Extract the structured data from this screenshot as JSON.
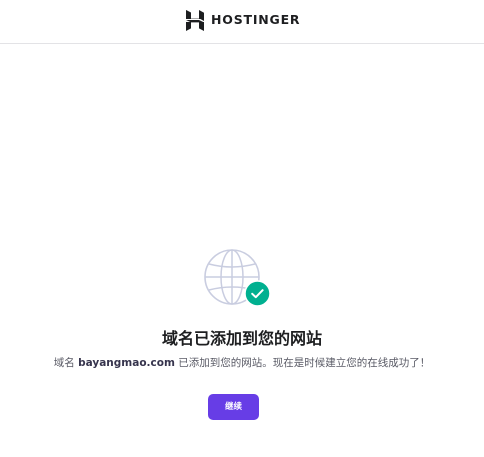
{
  "header": {
    "brand_name": "HOSTINGER",
    "logo_icon": "hostinger-logo-icon"
  },
  "main": {
    "illustration": {
      "globe_icon": "globe-icon",
      "check_icon": "check-circle-icon"
    },
    "title": "域名已添加到您的网站",
    "description": {
      "prefix": "域名 ",
      "domain": "bayangmao.com",
      "suffix": " 已添加到您的网站。现在是时候建立您的在线成功了！"
    },
    "continue_label": "继续"
  },
  "colors": {
    "accent": "#673de6",
    "success": "#00b090",
    "text_dark": "#1d1e20",
    "text_muted": "#5a5b66",
    "globe_stroke": "#c9cde0"
  }
}
